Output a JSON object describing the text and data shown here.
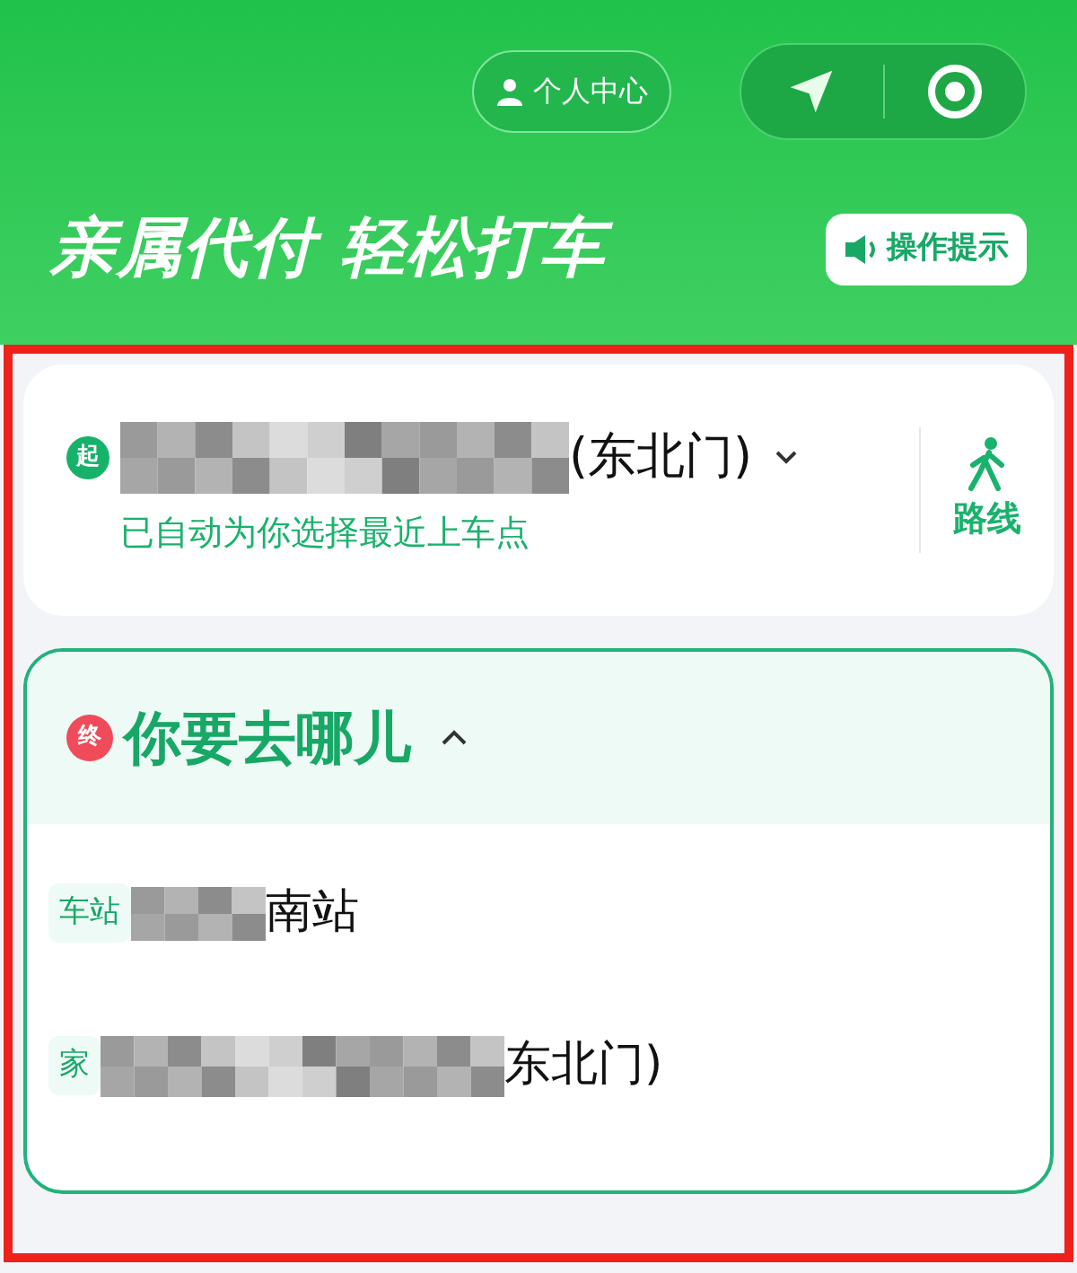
{
  "header": {
    "profile_button": "个人中心",
    "slogan": "亲属代付 轻松打车",
    "tips_button": "操作提示"
  },
  "pickup": {
    "badge": "起",
    "address": "(东北门)",
    "note": "已自动为你选择最近上车点",
    "route_button": "路线"
  },
  "destination": {
    "badge": "终",
    "prompt": "你要去哪儿",
    "expanded": true,
    "suggestions": [
      {
        "tag": "车站",
        "name": "南站"
      },
      {
        "tag": "家",
        "name": "东北门)"
      }
    ]
  }
}
